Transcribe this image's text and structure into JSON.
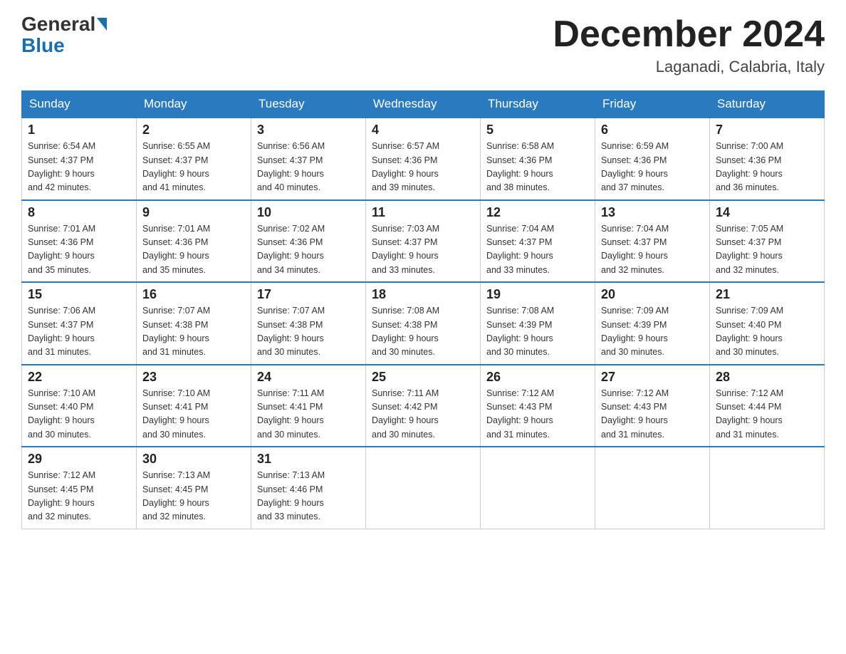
{
  "logo": {
    "general": "General",
    "blue": "Blue"
  },
  "title": "December 2024",
  "location": "Laganadi, Calabria, Italy",
  "days_of_week": [
    "Sunday",
    "Monday",
    "Tuesday",
    "Wednesday",
    "Thursday",
    "Friday",
    "Saturday"
  ],
  "weeks": [
    [
      {
        "day": "1",
        "sunrise": "6:54 AM",
        "sunset": "4:37 PM",
        "daylight": "9 hours and 42 minutes."
      },
      {
        "day": "2",
        "sunrise": "6:55 AM",
        "sunset": "4:37 PM",
        "daylight": "9 hours and 41 minutes."
      },
      {
        "day": "3",
        "sunrise": "6:56 AM",
        "sunset": "4:37 PM",
        "daylight": "9 hours and 40 minutes."
      },
      {
        "day": "4",
        "sunrise": "6:57 AM",
        "sunset": "4:36 PM",
        "daylight": "9 hours and 39 minutes."
      },
      {
        "day": "5",
        "sunrise": "6:58 AM",
        "sunset": "4:36 PM",
        "daylight": "9 hours and 38 minutes."
      },
      {
        "day": "6",
        "sunrise": "6:59 AM",
        "sunset": "4:36 PM",
        "daylight": "9 hours and 37 minutes."
      },
      {
        "day": "7",
        "sunrise": "7:00 AM",
        "sunset": "4:36 PM",
        "daylight": "9 hours and 36 minutes."
      }
    ],
    [
      {
        "day": "8",
        "sunrise": "7:01 AM",
        "sunset": "4:36 PM",
        "daylight": "9 hours and 35 minutes."
      },
      {
        "day": "9",
        "sunrise": "7:01 AM",
        "sunset": "4:36 PM",
        "daylight": "9 hours and 35 minutes."
      },
      {
        "day": "10",
        "sunrise": "7:02 AM",
        "sunset": "4:36 PM",
        "daylight": "9 hours and 34 minutes."
      },
      {
        "day": "11",
        "sunrise": "7:03 AM",
        "sunset": "4:37 PM",
        "daylight": "9 hours and 33 minutes."
      },
      {
        "day": "12",
        "sunrise": "7:04 AM",
        "sunset": "4:37 PM",
        "daylight": "9 hours and 33 minutes."
      },
      {
        "day": "13",
        "sunrise": "7:04 AM",
        "sunset": "4:37 PM",
        "daylight": "9 hours and 32 minutes."
      },
      {
        "day": "14",
        "sunrise": "7:05 AM",
        "sunset": "4:37 PM",
        "daylight": "9 hours and 32 minutes."
      }
    ],
    [
      {
        "day": "15",
        "sunrise": "7:06 AM",
        "sunset": "4:37 PM",
        "daylight": "9 hours and 31 minutes."
      },
      {
        "day": "16",
        "sunrise": "7:07 AM",
        "sunset": "4:38 PM",
        "daylight": "9 hours and 31 minutes."
      },
      {
        "day": "17",
        "sunrise": "7:07 AM",
        "sunset": "4:38 PM",
        "daylight": "9 hours and 30 minutes."
      },
      {
        "day": "18",
        "sunrise": "7:08 AM",
        "sunset": "4:38 PM",
        "daylight": "9 hours and 30 minutes."
      },
      {
        "day": "19",
        "sunrise": "7:08 AM",
        "sunset": "4:39 PM",
        "daylight": "9 hours and 30 minutes."
      },
      {
        "day": "20",
        "sunrise": "7:09 AM",
        "sunset": "4:39 PM",
        "daylight": "9 hours and 30 minutes."
      },
      {
        "day": "21",
        "sunrise": "7:09 AM",
        "sunset": "4:40 PM",
        "daylight": "9 hours and 30 minutes."
      }
    ],
    [
      {
        "day": "22",
        "sunrise": "7:10 AM",
        "sunset": "4:40 PM",
        "daylight": "9 hours and 30 minutes."
      },
      {
        "day": "23",
        "sunrise": "7:10 AM",
        "sunset": "4:41 PM",
        "daylight": "9 hours and 30 minutes."
      },
      {
        "day": "24",
        "sunrise": "7:11 AM",
        "sunset": "4:41 PM",
        "daylight": "9 hours and 30 minutes."
      },
      {
        "day": "25",
        "sunrise": "7:11 AM",
        "sunset": "4:42 PM",
        "daylight": "9 hours and 30 minutes."
      },
      {
        "day": "26",
        "sunrise": "7:12 AM",
        "sunset": "4:43 PM",
        "daylight": "9 hours and 31 minutes."
      },
      {
        "day": "27",
        "sunrise": "7:12 AM",
        "sunset": "4:43 PM",
        "daylight": "9 hours and 31 minutes."
      },
      {
        "day": "28",
        "sunrise": "7:12 AM",
        "sunset": "4:44 PM",
        "daylight": "9 hours and 31 minutes."
      }
    ],
    [
      {
        "day": "29",
        "sunrise": "7:12 AM",
        "sunset": "4:45 PM",
        "daylight": "9 hours and 32 minutes."
      },
      {
        "day": "30",
        "sunrise": "7:13 AM",
        "sunset": "4:45 PM",
        "daylight": "9 hours and 32 minutes."
      },
      {
        "day": "31",
        "sunrise": "7:13 AM",
        "sunset": "4:46 PM",
        "daylight": "9 hours and 33 minutes."
      },
      null,
      null,
      null,
      null
    ]
  ],
  "labels": {
    "sunrise": "Sunrise:",
    "sunset": "Sunset:",
    "daylight": "Daylight:"
  }
}
